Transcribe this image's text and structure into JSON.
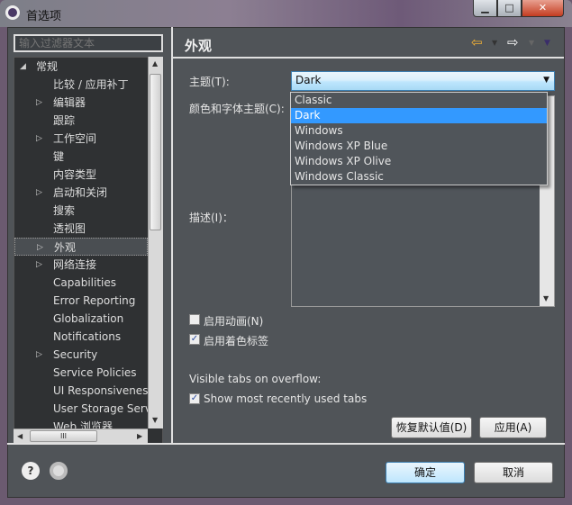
{
  "window": {
    "title": "首选项",
    "buttons": {
      "minimize": "▁",
      "maximize": "□",
      "close": "✕"
    }
  },
  "filter": {
    "placeholder": "输入过滤器文本"
  },
  "tree": {
    "items": [
      {
        "label": "常规",
        "level": 0,
        "expander": "expanded"
      },
      {
        "label": "比较 / 应用补丁",
        "level": 1,
        "expander": "none"
      },
      {
        "label": "编辑器",
        "level": 1,
        "expander": "collapsed"
      },
      {
        "label": "跟踪",
        "level": 1,
        "expander": "none"
      },
      {
        "label": "工作空间",
        "level": 1,
        "expander": "collapsed"
      },
      {
        "label": "键",
        "level": 1,
        "expander": "none"
      },
      {
        "label": "内容类型",
        "level": 1,
        "expander": "none"
      },
      {
        "label": "启动和关闭",
        "level": 1,
        "expander": "collapsed"
      },
      {
        "label": "搜索",
        "level": 1,
        "expander": "none"
      },
      {
        "label": "透视图",
        "level": 1,
        "expander": "none"
      },
      {
        "label": "外观",
        "level": 1,
        "expander": "collapsed",
        "selected": true
      },
      {
        "label": "网络连接",
        "level": 1,
        "expander": "collapsed"
      },
      {
        "label": "Capabilities",
        "level": 1,
        "expander": "none"
      },
      {
        "label": "Error Reporting",
        "level": 1,
        "expander": "none"
      },
      {
        "label": "Globalization",
        "level": 1,
        "expander": "none"
      },
      {
        "label": "Notifications",
        "level": 1,
        "expander": "none"
      },
      {
        "label": "Security",
        "level": 1,
        "expander": "collapsed"
      },
      {
        "label": "Service Policies",
        "level": 1,
        "expander": "none"
      },
      {
        "label": "UI Responsiveness",
        "level": 1,
        "expander": "none"
      },
      {
        "label": "User Storage Service",
        "level": 1,
        "expander": "none"
      },
      {
        "label": "Web 浏览器",
        "level": 1,
        "expander": "none"
      }
    ],
    "hscroll_grip": "III"
  },
  "page": {
    "title": "外观",
    "nav": {
      "back": "⇦",
      "forward": "⇨",
      "menu": "▼"
    },
    "theme_label": "主题(T):",
    "theme_value": "Dark",
    "theme_options": [
      "Classic",
      "Dark",
      "Windows",
      "Windows XP Blue",
      "Windows XP Olive",
      "Windows Classic"
    ],
    "color_font_label": "颜色和字体主题(C):",
    "description_label": "描述(I)：",
    "enable_animation": {
      "label": "启用动画(N)",
      "checked": false
    },
    "enable_colored_labels": {
      "label": "启用着色标签",
      "checked": true
    },
    "visible_tabs_label": "Visible tabs on overflow:",
    "show_mru": {
      "label": "Show most recently used tabs",
      "checked": true
    },
    "restore_defaults": "恢复默认值(D)",
    "apply": "应用(A)"
  },
  "footer": {
    "help": "?",
    "ok": "确定",
    "cancel": "取消"
  },
  "colors": {
    "accent": "#3399ff",
    "panel": "#505458",
    "tree_bg": "#2f3133"
  }
}
